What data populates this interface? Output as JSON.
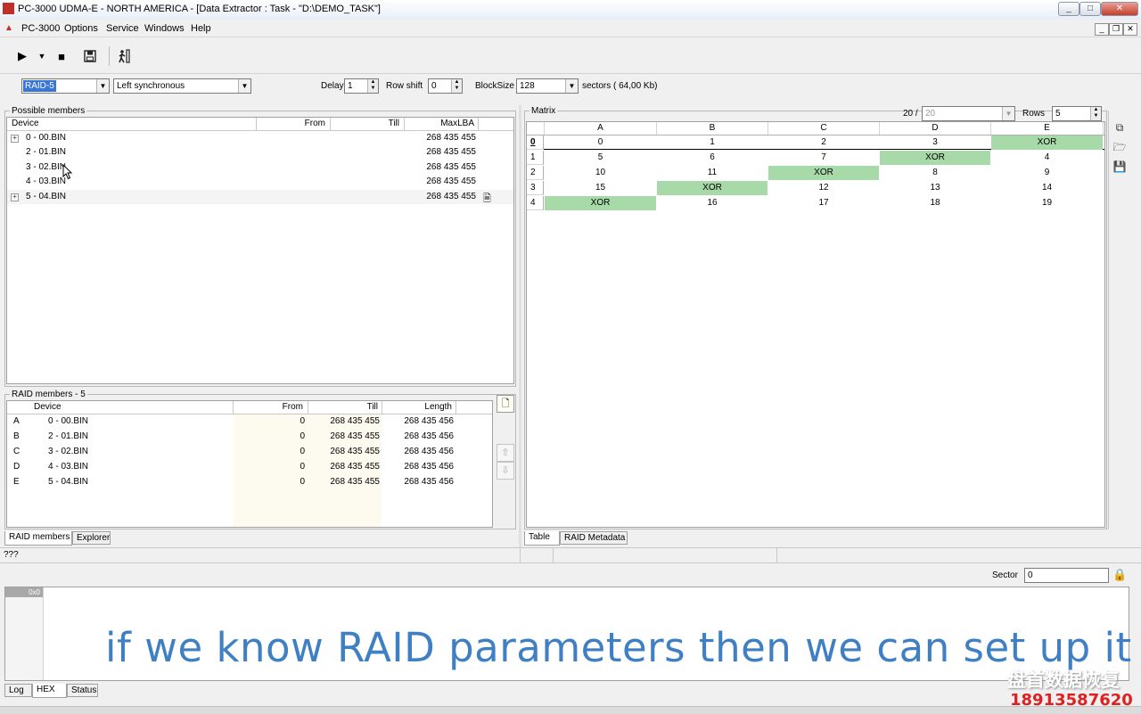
{
  "window": {
    "title": "PC-3000 UDMA-E - NORTH AMERICA - [Data Extractor : Task - \"D:\\DEMO_TASK\"]",
    "min": "_",
    "max": "□",
    "close": "✕"
  },
  "menu": [
    "PC-3000",
    "Options",
    "Service",
    "Windows",
    "Help"
  ],
  "options": {
    "raid_type": "RAID-5",
    "layout": "Left synchronous",
    "delay_label": "Delay",
    "delay_value": "1",
    "rowshift_label": "Row shift",
    "rowshift_value": "0",
    "blocksize_label": "BlockSize",
    "blocksize_value": "128",
    "sectors_text": "sectors ( 64,00 Kb)"
  },
  "possible": {
    "title": "Possible members",
    "headers": [
      "Device",
      "From",
      "Till",
      "MaxLBA"
    ],
    "rows": [
      {
        "device": "0 - 00.BIN",
        "maxlba": "268 435 455",
        "exp": "+"
      },
      {
        "device": "2 - 01.BIN",
        "maxlba": "268 435 455",
        "exp": ""
      },
      {
        "device": "3 - 02.BIN",
        "maxlba": "268 435 455",
        "exp": ""
      },
      {
        "device": "4 - 03.BIN",
        "maxlba": "268 435 455",
        "exp": ""
      },
      {
        "device": "5 - 04.BIN",
        "maxlba": "268 435 455",
        "exp": "+"
      }
    ]
  },
  "members": {
    "title": "RAID members - 5",
    "headers": [
      "Device",
      "From",
      "Till",
      "Length"
    ],
    "rows": [
      {
        "id": "A",
        "device": "0 - 00.BIN",
        "from": "0",
        "till": "268 435 455",
        "length": "268 435 456"
      },
      {
        "id": "B",
        "device": "2 - 01.BIN",
        "from": "0",
        "till": "268 435 455",
        "length": "268 435 456"
      },
      {
        "id": "C",
        "device": "3 - 02.BIN",
        "from": "0",
        "till": "268 435 455",
        "length": "268 435 456"
      },
      {
        "id": "D",
        "device": "4 - 03.BIN",
        "from": "0",
        "till": "268 435 455",
        "length": "268 435 456"
      },
      {
        "id": "E",
        "device": "5 - 04.BIN",
        "from": "0",
        "till": "268 435 455",
        "length": "268 435 456"
      }
    ]
  },
  "left_tabs": [
    "RAID members",
    "Explorer"
  ],
  "matrix": {
    "title": "Matrix",
    "count_text": "20 /",
    "count_value": "20",
    "rows_label": "Rows",
    "rows_value": "5",
    "columns": [
      "A",
      "B",
      "C",
      "D",
      "E"
    ],
    "rows": [
      {
        "label": "0",
        "cells": [
          "0",
          "1",
          "2",
          "3",
          "XOR"
        ]
      },
      {
        "label": "1",
        "cells": [
          "5",
          "6",
          "7",
          "XOR",
          "4"
        ]
      },
      {
        "label": "2",
        "cells": [
          "10",
          "11",
          "XOR",
          "8",
          "9"
        ]
      },
      {
        "label": "3",
        "cells": [
          "15",
          "XOR",
          "12",
          "13",
          "14"
        ]
      },
      {
        "label": "4",
        "cells": [
          "XOR",
          "16",
          "17",
          "18",
          "19"
        ]
      }
    ]
  },
  "right_tabs": [
    "Table",
    "RAID Metadata"
  ],
  "status_text": "???",
  "hex": {
    "sector_label": "Sector",
    "sector_value": "0",
    "offset": "0x0"
  },
  "bottom_tabs": [
    "Log",
    "HEX",
    "Status"
  ],
  "caption": "if we know RAID parameters then we can set up it",
  "watermark": {
    "name": "盘首数据恢复",
    "phone": "18913587620"
  },
  "colors": {
    "xor_cell": "#a8d9a8",
    "caption": "#3f7fc3",
    "selection": "#3875d7"
  }
}
